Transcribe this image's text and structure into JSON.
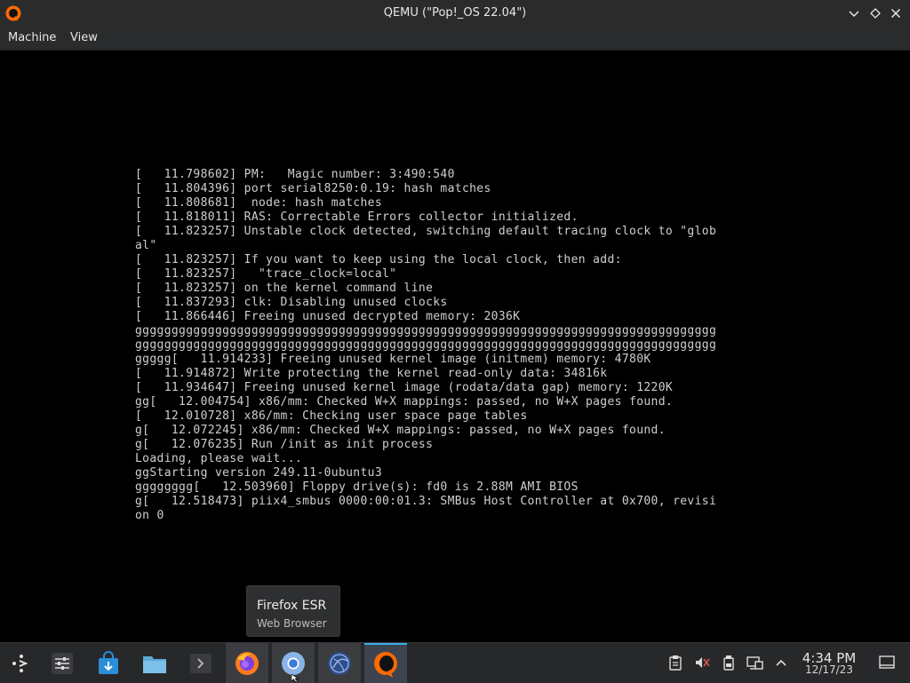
{
  "window": {
    "title": "QEMU (\"Pop!_OS 22.04\")",
    "controls": [
      "minimize",
      "maximize",
      "close"
    ]
  },
  "menubar": {
    "items": [
      {
        "label": "Machine"
      },
      {
        "label": "View"
      }
    ]
  },
  "console": {
    "lines": [
      "[   11.798602] PM:   Magic number: 3:490:540",
      "[   11.804396] port serial8250:0.19: hash matches",
      "[   11.808681]  node: hash matches",
      "[   11.818011] RAS: Correctable Errors collector initialized.",
      "[   11.823257] Unstable clock detected, switching default tracing clock to \"glob",
      "al\"",
      "[   11.823257] If you want to keep using the local clock, then add:",
      "[   11.823257]   \"trace_clock=local\"",
      "[   11.823257] on the kernel command line",
      "[   11.837293] clk: Disabling unused clocks",
      "[   11.866446] Freeing unused decrypted memory: 2036K",
      "gggggggggggggggggggggggggggggggggggggggggggggggggggggggggggggggggggggggggggggggg",
      "gggggggggggggggggggggggggggggggggggggggggggggggggggggggggggggggggggggggggggggggg",
      "ggggg[   11.914233] Freeing unused kernel image (initmem) memory: 4780K",
      "[   11.914872] Write protecting the kernel read-only data: 34816k",
      "[   11.934647] Freeing unused kernel image (rodata/data gap) memory: 1220K",
      "gg[   12.004754] x86/mm: Checked W+X mappings: passed, no W+X pages found.",
      "[   12.010728] x86/mm: Checking user space page tables",
      "g[   12.072245] x86/mm: Checked W+X mappings: passed, no W+X pages found.",
      "g[   12.076235] Run /init as init process",
      "Loading, please wait...",
      "ggStarting version 249.11-0ubuntu3",
      "gggggggg[   12.503960] Floppy drive(s): fd0 is 2.88M AMI BIOS",
      "g[   12.518473] piix4_smbus 0000:00:01.3: SMBus Host Controller at 0x700, revisi",
      "on 0"
    ]
  },
  "tooltip": {
    "title": "Firefox ESR",
    "subtitle": "Web Browser"
  },
  "taskbar": {
    "items": [
      {
        "name": "application-launcher",
        "icon": "pop-launcher-icon"
      },
      {
        "name": "settings",
        "icon": "settings-sliders-icon"
      },
      {
        "name": "software-store",
        "icon": "store-bag-icon"
      },
      {
        "name": "file-manager",
        "icon": "folder-icon"
      },
      {
        "name": "terminal",
        "icon": "terminal-icon"
      },
      {
        "name": "firefox-esr",
        "icon": "firefox-icon"
      },
      {
        "name": "chromium",
        "icon": "chromium-icon"
      },
      {
        "name": "network-browser",
        "icon": "globe-icon"
      },
      {
        "name": "qemu",
        "icon": "qemu-icon"
      }
    ],
    "tray": [
      "clipboard-icon",
      "volume-muted-icon",
      "storage-icon",
      "network-icon",
      "expand-tray-icon"
    ],
    "clock": {
      "time": "4:34 PM",
      "date": "12/17/23"
    }
  },
  "colors": {
    "titlebar_bg": "#2b2b2c",
    "console_bg": "#000000",
    "console_fg": "#cfcfcf",
    "taskbar_bg": "#27282a",
    "accent": "#3daee9"
  }
}
